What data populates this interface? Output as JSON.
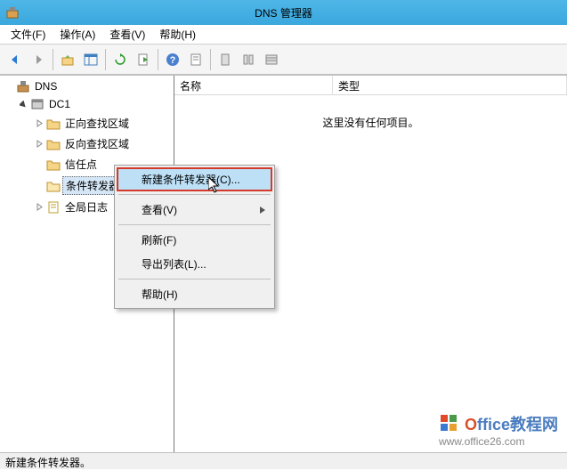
{
  "title": "DNS 管理器",
  "menubar": {
    "file": "文件(F)",
    "action": "操作(A)",
    "view": "查看(V)",
    "help": "帮助(H)"
  },
  "tree": {
    "root": "DNS",
    "server": "DC1",
    "nodes": {
      "fwd": "正向查找区域",
      "rev": "反向查找区域",
      "trust": "信任点",
      "cond": "条件转发器",
      "global": "全局日志"
    }
  },
  "list": {
    "col_name": "名称",
    "col_type": "类型",
    "empty": "这里没有任何项目。"
  },
  "context_menu": {
    "new_cond": "新建条件转发器(C)...",
    "view": "查看(V)",
    "refresh": "刷新(F)",
    "export": "导出列表(L)...",
    "help": "帮助(H)"
  },
  "statusbar": "新建条件转发器。",
  "watermark": {
    "brand": "Office教程网",
    "url": "www.office26.com"
  }
}
